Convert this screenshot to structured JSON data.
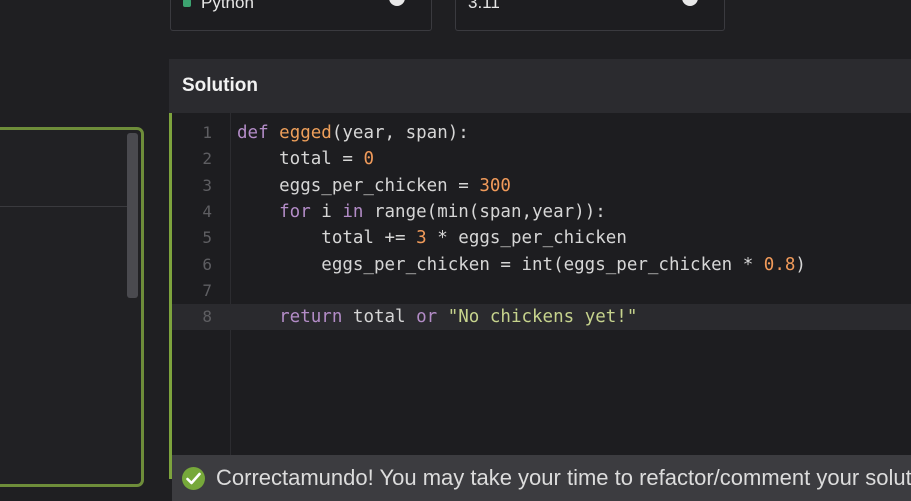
{
  "top_bar": {
    "language_label": "Python",
    "version_label": "3.11"
  },
  "solution": {
    "title": "Solution",
    "code_lines": [
      {
        "n": "1",
        "tokens": [
          [
            "kw",
            "def "
          ],
          [
            "fn",
            "egged"
          ],
          [
            "op",
            "(year, span):"
          ]
        ]
      },
      {
        "n": "2",
        "tokens": [
          [
            "op",
            "    total = "
          ],
          [
            "num",
            "0"
          ]
        ]
      },
      {
        "n": "3",
        "tokens": [
          [
            "op",
            "    eggs_per_chicken = "
          ],
          [
            "num",
            "300"
          ]
        ]
      },
      {
        "n": "4",
        "tokens": [
          [
            "kw",
            "    for "
          ],
          [
            "op",
            "i "
          ],
          [
            "kw",
            "in "
          ],
          [
            "op",
            "range(min(span,year)):"
          ]
        ]
      },
      {
        "n": "5",
        "tokens": [
          [
            "op",
            "        total += "
          ],
          [
            "num",
            "3"
          ],
          [
            "op",
            " * eggs_per_chicken"
          ]
        ]
      },
      {
        "n": "6",
        "tokens": [
          [
            "op",
            "        eggs_per_chicken = int(eggs_per_chicken * "
          ],
          [
            "num",
            "0.8"
          ],
          [
            "op",
            ")"
          ]
        ]
      },
      {
        "n": "7",
        "tokens": [
          [
            "op",
            ""
          ]
        ]
      },
      {
        "n": "8",
        "tokens": [
          [
            "kw",
            "    return "
          ],
          [
            "op",
            "total "
          ],
          [
            "kw",
            "or "
          ],
          [
            "str",
            "\"No chickens yet!\""
          ]
        ]
      }
    ],
    "active_line": "8"
  },
  "result": {
    "message": "Correctamundo! You may take your time to refactor/comment your solution."
  },
  "colors": {
    "accent_green": "#7da33d",
    "success": "#76a83a"
  }
}
